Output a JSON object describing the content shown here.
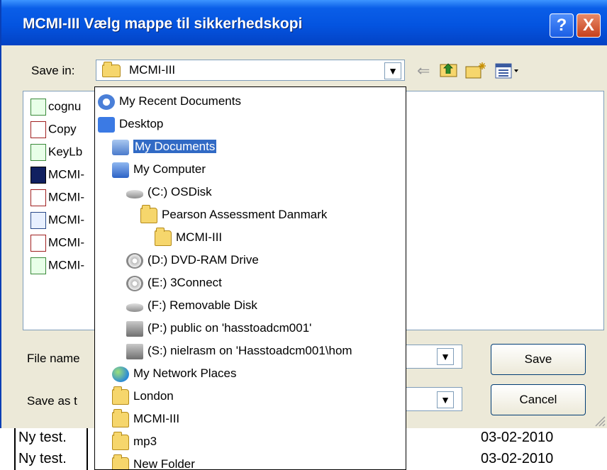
{
  "title": "MCMI-III  Vælg mappe til sikkerhedskopi",
  "title_buttons": {
    "help": "?",
    "close": "X"
  },
  "save_in": {
    "label": "Save in:",
    "value": "MCMI-III"
  },
  "toolbar": {
    "back_icon": "back-arrow-icon",
    "up_icon": "up-folder-icon",
    "new_folder_icon": "new-folder-icon",
    "views_icon": "views-menu-icon"
  },
  "files": [
    "cognu",
    "Copy",
    "KeyLb",
    "MCMI-",
    "MCMI-",
    "MCMI-",
    "MCMI-",
    "MCMI-"
  ],
  "file_name": {
    "label": "File name",
    "value": ""
  },
  "save_as_type": {
    "label": "Save as t",
    "value": ""
  },
  "buttons": {
    "save": "Save",
    "cancel": "Cancel"
  },
  "dropdown_items": [
    {
      "label": "My Recent Documents",
      "icon": "recent-documents-icon"
    },
    {
      "label": "Desktop",
      "icon": "desktop-icon"
    },
    {
      "label": "My Documents",
      "icon": "my-documents-icon",
      "selected": true
    },
    {
      "label": "My Computer",
      "icon": "my-computer-icon"
    },
    {
      "label": "(C:) OSDisk",
      "icon": "hard-drive-icon"
    },
    {
      "label": "Pearson Assessment Danmark",
      "icon": "folder-icon"
    },
    {
      "label": "MCMI-III",
      "icon": "folder-icon"
    },
    {
      "label": "(D:) DVD-RAM Drive",
      "icon": "dvd-drive-icon"
    },
    {
      "label": "(E:) 3Connect",
      "icon": "cd-drive-icon"
    },
    {
      "label": "(F:) Removable Disk",
      "icon": "removable-disk-icon"
    },
    {
      "label": "(P:) public on 'hasstoadcm001'",
      "icon": "network-drive-icon"
    },
    {
      "label": "(S:) nielrasm on 'Hasstoadcm001\\hom",
      "icon": "network-drive-icon"
    },
    {
      "label": "My Network Places",
      "icon": "network-places-icon"
    },
    {
      "label": "London",
      "icon": "folder-icon"
    },
    {
      "label": "MCMI-III",
      "icon": "folder-icon"
    },
    {
      "label": "mp3",
      "icon": "folder-icon"
    },
    {
      "label": "New Folder",
      "icon": "folder-icon"
    }
  ],
  "background_rows": [
    {
      "name": "Ny test.",
      "date": "03-02-2010"
    },
    {
      "name": "Ny test.",
      "date": "03-02-2010"
    }
  ]
}
